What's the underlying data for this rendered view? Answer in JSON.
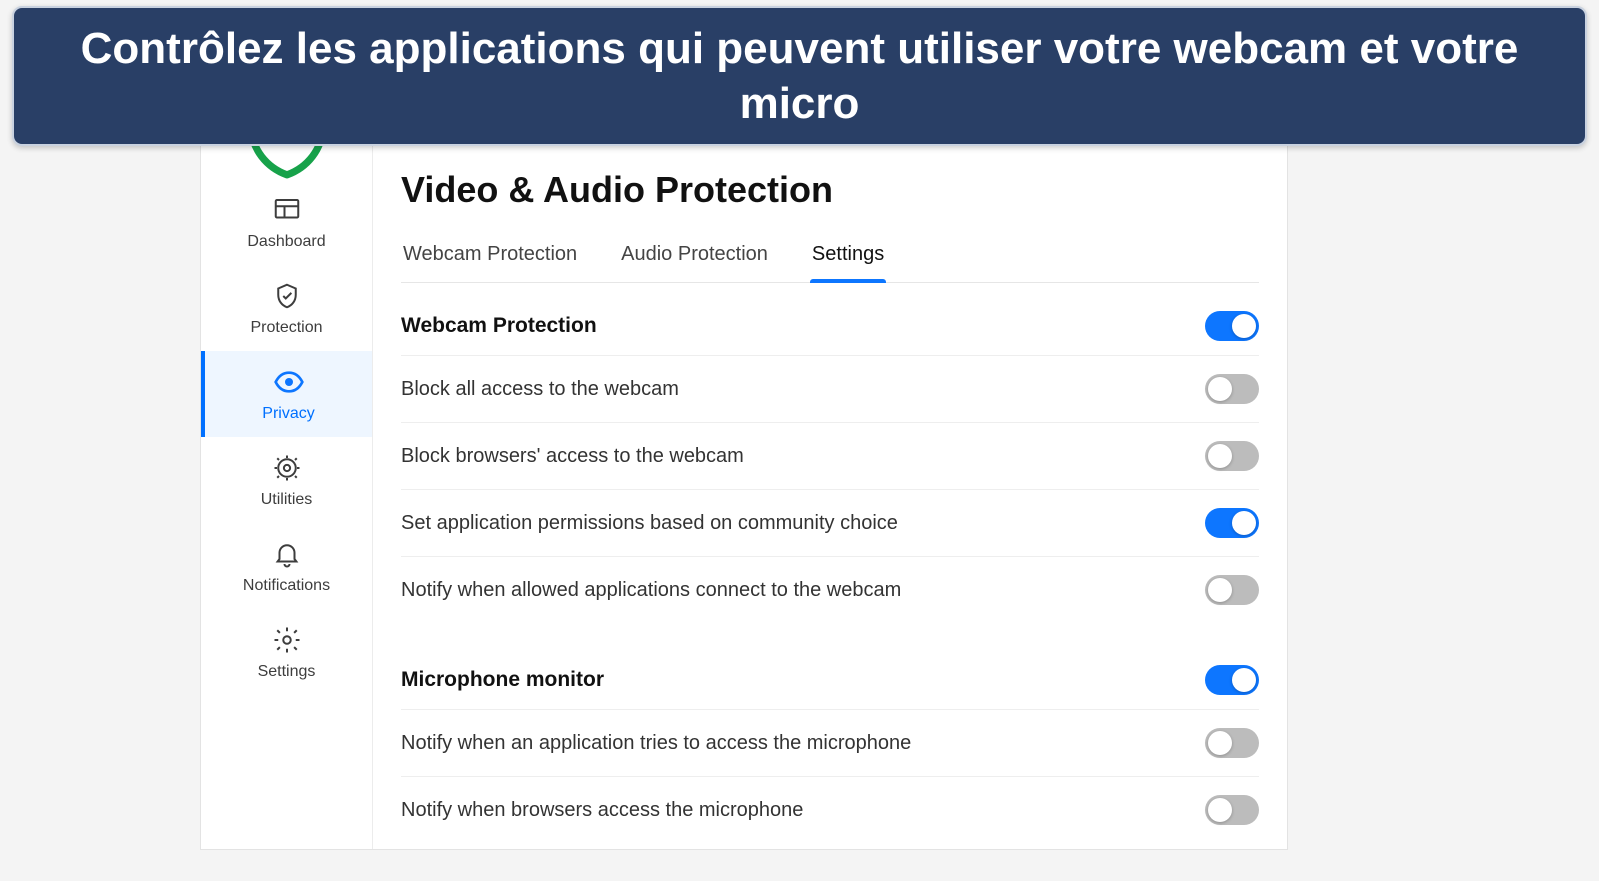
{
  "banner": {
    "text": "Contrôlez les applications qui peuvent utiliser votre webcam et votre micro"
  },
  "sidebar": {
    "items": [
      {
        "label": "Dashboard"
      },
      {
        "label": "Protection"
      },
      {
        "label": "Privacy"
      },
      {
        "label": "Utilities"
      },
      {
        "label": "Notifications"
      },
      {
        "label": "Settings"
      }
    ]
  },
  "main": {
    "title": "Video & Audio Protection",
    "tabs": [
      {
        "label": "Webcam Protection"
      },
      {
        "label": "Audio Protection"
      },
      {
        "label": "Settings"
      }
    ],
    "groups": [
      {
        "heading": "Webcam Protection",
        "enabled": true,
        "rows": [
          {
            "label": "Block all access to the webcam",
            "on": false
          },
          {
            "label": "Block browsers' access to the webcam",
            "on": false
          },
          {
            "label": "Set application permissions based on community choice",
            "on": true
          },
          {
            "label": "Notify when allowed applications connect to the webcam",
            "on": false
          }
        ]
      },
      {
        "heading": "Microphone monitor",
        "enabled": true,
        "rows": [
          {
            "label": "Notify when an application tries to access the microphone",
            "on": false
          },
          {
            "label": "Notify when browsers access the microphone",
            "on": false
          }
        ]
      }
    ]
  }
}
